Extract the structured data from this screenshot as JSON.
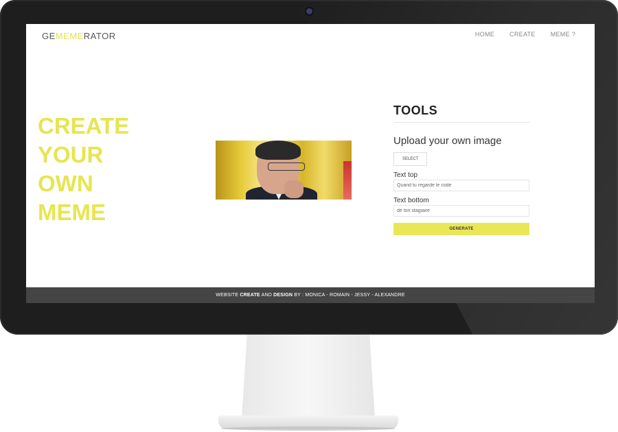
{
  "nav": {
    "logo": {
      "part1": "GE",
      "part2": "MEME",
      "part3": "RATOR"
    },
    "links": [
      "HOME",
      "CREATE",
      "MEME ?"
    ]
  },
  "hero": {
    "lines": [
      "CREATE",
      "YOUR",
      "OWN",
      "MEME"
    ]
  },
  "tools": {
    "title": "TOOLS",
    "upload_title": "Upload your own image",
    "select_label": "SELECT",
    "text_top_label": "Text top",
    "text_top_value": "Quand tu regarde le code",
    "text_bottom_label": "Text bottom",
    "text_bottom_value": "de ton stagiaire",
    "generate_label": "GENERATE"
  },
  "footer": {
    "prefix": "WEBSITE ",
    "create": "CREATE",
    "and": " AND ",
    "design": "DESIGN",
    "credits": " BY : MONICA - ROMAIN - JESSY - ALEXANDRE"
  },
  "colors": {
    "accent": "#e7e551",
    "footer_bg": "#454545",
    "bezel": "#1e1e1e"
  }
}
